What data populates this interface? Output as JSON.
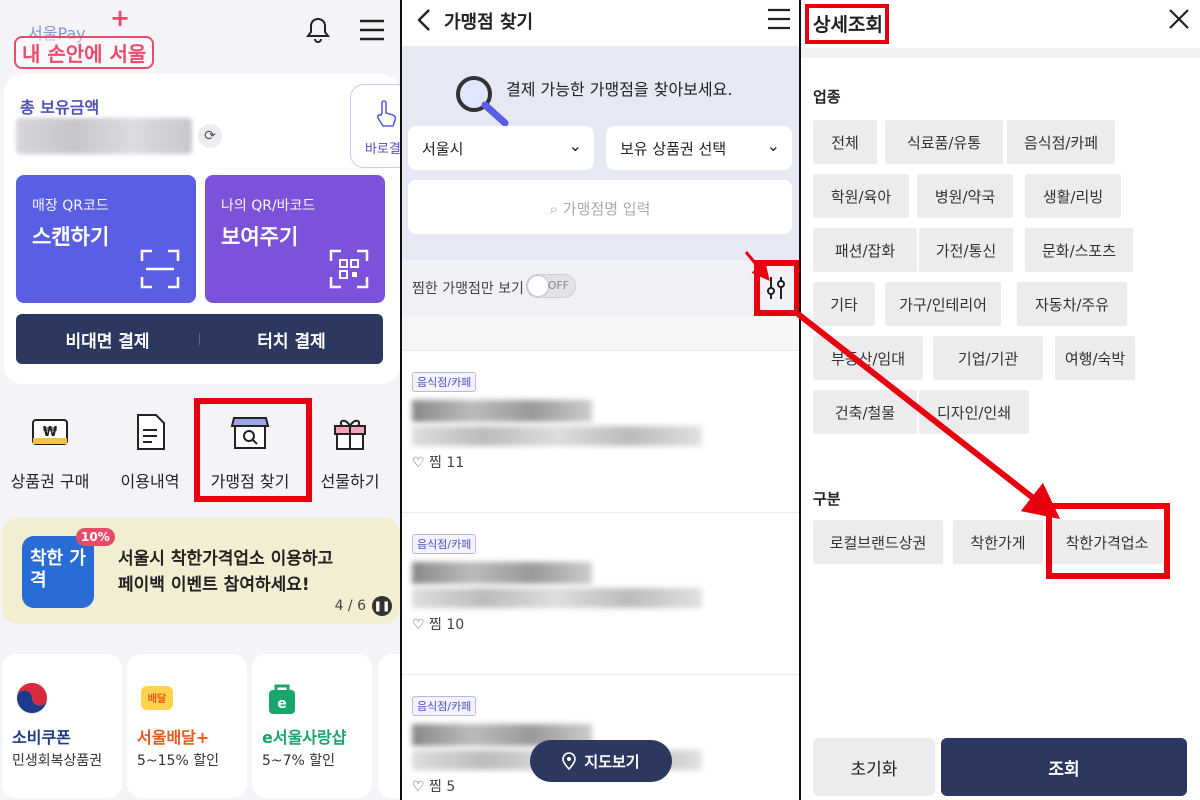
{
  "home": {
    "logo_pay": "서울Pay",
    "logo_slogan": "내 손안에 서울",
    "total_label": "총 보유금액",
    "shortcut_label": "바로결",
    "tile_scan": {
      "small": "매장 QR코드",
      "big": "스캔하기"
    },
    "tile_show": {
      "small": "나의 QR/바코드",
      "big": "보여주기"
    },
    "pay_nonface": "비대면 결제",
    "pay_touch": "터치 결제",
    "menu": [
      {
        "label": "상품권 구매",
        "icon": "voucher-icon"
      },
      {
        "label": "이용내역",
        "icon": "document-icon"
      },
      {
        "label": "가맹점 찾기",
        "icon": "store-search-icon"
      },
      {
        "label": "선물하기",
        "icon": "gift-icon"
      }
    ],
    "banner": {
      "badge": "10%",
      "icon_text": "착한 가격",
      "line1": "서울시 착한가격업소 이용하고",
      "line2": "페이백 이벤트 참여하세요!",
      "page": "4 / 6"
    },
    "promos": [
      {
        "title": "소비쿠폰",
        "sub": "민생회복상품권",
        "color": "#1e3a8a"
      },
      {
        "title": "서울배달+",
        "sub": "5~15% 할인",
        "color": "#e85a1c"
      },
      {
        "title": "e서울사랑샵",
        "sub": "5~7% 할인",
        "color": "#1aa56b"
      }
    ]
  },
  "finder": {
    "title": "가맹점 찾기",
    "hero_text": "결제 가능한 가맹점을 찾아보세요.",
    "region_select": "서울시",
    "voucher_select": "보유 상품권 선택",
    "search_placeholder": "가맹점명 입력",
    "favorites_label": "찜한 가맹점만 보기",
    "toggle_state": "OFF",
    "stores": [
      {
        "category": "음식점/카페",
        "likes": "찜 11"
      },
      {
        "category": "음식점/카페",
        "likes": "찜 10"
      },
      {
        "category": "음식점/카페",
        "likes": "찜 5"
      }
    ],
    "map_button": "지도보기"
  },
  "detail": {
    "title": "상세조회",
    "industry_label": "업종",
    "industries": [
      "전체",
      "식료품/유통",
      "음식점/카페",
      "학원/육아",
      "병원/약국",
      "생활/리빙",
      "패션/잡화",
      "가전/통신",
      "문화/스포츠",
      "기타",
      "가구/인테리어",
      "자동차/주유",
      "부동산/임대",
      "기업/기관",
      "여행/숙박",
      "건축/철물",
      "디자인/인쇄"
    ],
    "division_label": "구분",
    "divisions": [
      "로컬브랜드상권",
      "착한가게",
      "착한가격업소"
    ],
    "reset_button": "초기화",
    "search_button": "조회"
  },
  "colors": {
    "brand_navy": "#2c3860",
    "highlight_red": "#e8000e",
    "scan_tile": "#5a5ee3",
    "show_tile": "#7b52d9"
  }
}
